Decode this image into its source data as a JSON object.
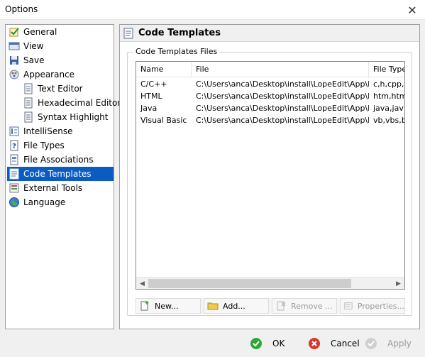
{
  "window": {
    "title": "Options",
    "close_glyph": "✕"
  },
  "tree": {
    "items": [
      {
        "label": "General",
        "icon": "checkbox-icon",
        "indent": 0
      },
      {
        "label": "View",
        "icon": "view-icon",
        "indent": 0
      },
      {
        "label": "Save",
        "icon": "floppy-disk-icon",
        "indent": 0
      },
      {
        "label": "Appearance",
        "icon": "appearance-icon",
        "indent": 0
      },
      {
        "label": "Text Editor",
        "icon": "document-icon",
        "indent": 1
      },
      {
        "label": "Hexadecimal Editor",
        "icon": "document-icon",
        "indent": 1
      },
      {
        "label": "Syntax Highlight",
        "icon": "document-icon",
        "indent": 1
      },
      {
        "label": "IntelliSense",
        "icon": "intellisense-icon",
        "indent": 0
      },
      {
        "label": "File Types",
        "icon": "help-icon",
        "indent": 0
      },
      {
        "label": "File Associations",
        "icon": "file-associations-icon",
        "indent": 0
      },
      {
        "label": "Code Templates",
        "icon": "code-templates-icon",
        "indent": 0,
        "selected": true
      },
      {
        "label": "External Tools",
        "icon": "external-tools-icon",
        "indent": 0
      },
      {
        "label": "Language",
        "icon": "globe-icon",
        "indent": 0
      }
    ]
  },
  "panel": {
    "title": "Code Templates",
    "group_label": "Code Templates Files",
    "columns": [
      "Name",
      "File",
      "File Type"
    ],
    "rows": [
      [
        "C/C++",
        "C:\\Users\\anca\\Desktop\\install\\LopeEdit\\App\\L...",
        "c,h,cpp,h"
      ],
      [
        "HTML",
        "C:\\Users\\anca\\Desktop\\install\\LopeEdit\\App\\L...",
        "htm,html"
      ],
      [
        "Java",
        "C:\\Users\\anca\\Desktop\\install\\LopeEdit\\App\\L...",
        "java,jav"
      ],
      [
        "Visual Basic",
        "C:\\Users\\anca\\Desktop\\install\\LopeEdit\\App\\L...",
        "vb,vbs,ba"
      ]
    ],
    "scroll_left": "◀",
    "scroll_right": "▶",
    "buttons": {
      "new": "New...",
      "add": "Add...",
      "remove": "Remove ...",
      "properties": "Properties..."
    }
  },
  "footer": {
    "ok": "OK",
    "cancel": "Cancel",
    "apply": "Apply"
  },
  "colors": {
    "selection": "#0a5cc2",
    "ok_green": "#2fa53a",
    "cancel_red": "#d73a2b"
  }
}
